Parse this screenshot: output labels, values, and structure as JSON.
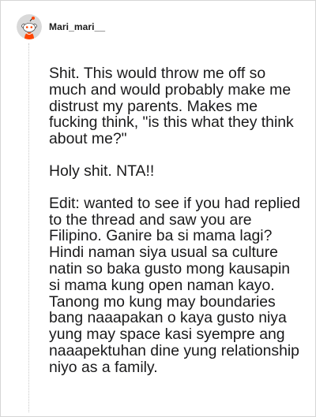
{
  "post": {
    "username": "Mari_mari__",
    "avatar_icon": "reddit-snoo-avatar-icon",
    "paragraphs": [
      "Shit. This would throw me off so much and would probably make me distrust my parents. Makes me fucking think, \"is this what they think about me?\"",
      "Holy shit. NTA!!",
      "Edit: wanted to see if you had replied to the thread and saw you are Filipino. Ganire ba si mama lagi? Hindi naman siya usual sa culture natin so baka gusto mong kausapin si mama kung open naman kayo. Tanong mo kung may boundaries bang naaapakan o kaya gusto niya yung may space kasi syempre ang naaapektuhan dine yung relationship niyo as a family."
    ]
  },
  "colors": {
    "avatar_background": "#d9d9d9",
    "avatar_accent": "#ff4500"
  }
}
